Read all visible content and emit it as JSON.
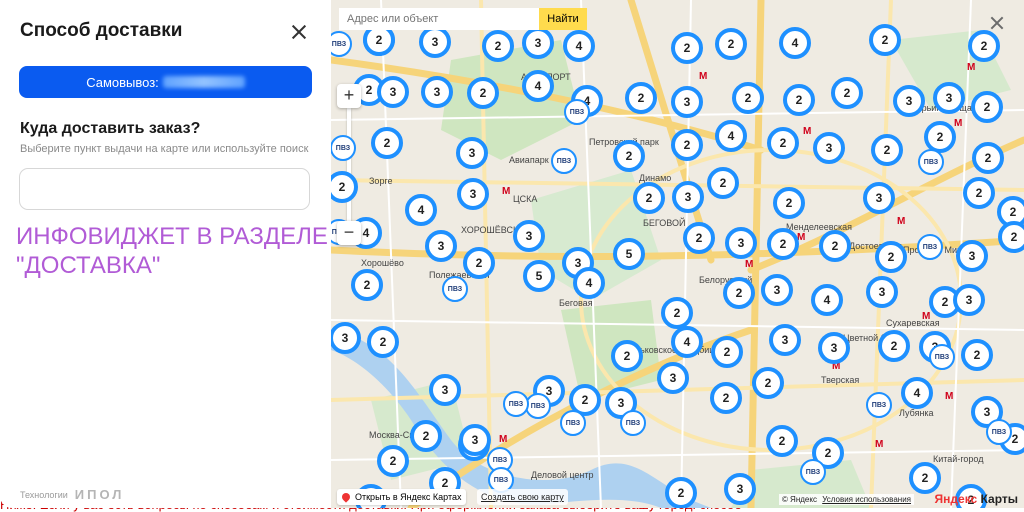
{
  "panel": {
    "title": "Способ доставки",
    "pickup_label": "Самовывоз:",
    "question": "Куда доставить заказ?",
    "hint": "Выберите пункт выдачи на карте или используйте поиск",
    "address_value": "",
    "tech_label": "Технологии",
    "brand_logo_text": "ИПОЛ"
  },
  "overlay_label": {
    "line1": "ИНФОВИДЖЕТ В РАЗДЕЛЕ",
    "line2": "\"ДОСТАВКА\""
  },
  "page_bg_text": "Ниже: Если у вас есть вопросы по способам и стоимости доставки. При оформлении заказа выберите вашу город. способ",
  "map": {
    "search_placeholder": "Адрес или объект",
    "search_button": "Найти",
    "zoom_in": "+",
    "zoom_out": "−",
    "open_in_yandex": "Открыть в Яндекс Картах",
    "create_map": "Создать свою карту",
    "copyright": "© Яндекс",
    "terms": "Условия использования",
    "logo_part1": "Яндекс",
    "logo_part2": " Карты",
    "accent_color": "#1e90ff",
    "button_color": "#ffdb4d",
    "pvz_label": "ПВЗ",
    "places": [
      "АЭРОПОРТ",
      "Авиапарк",
      "ЦСКА",
      "ХОРОШЁВСКИЙ",
      "Петровский парк",
      "Динамо",
      "БЕГОВОЙ",
      "Беговая",
      "Белорусский",
      "Менделеевская",
      "Достоевская",
      "Проспект Мира",
      "Марьина Роща",
      "Цветной бу...",
      "Тверская",
      "Лубянка",
      "Китай-город",
      "Деловой центр",
      "Ваганьковское кладбище",
      "Зорге",
      "Хорошёво",
      "Полежаевская",
      "Москва-Сити",
      "Сухаревская"
    ],
    "clusters": [
      "2",
      "3",
      "2",
      "3",
      "4",
      "2",
      "2",
      "4",
      "2",
      "2",
      "2",
      "3",
      "3",
      "2",
      "4",
      "4",
      "2",
      "3",
      "2",
      "2",
      "2",
      "3",
      "3",
      "2",
      "2",
      "3",
      "2",
      "2",
      "4",
      "2",
      "3",
      "2",
      "2",
      "2",
      "2",
      "4",
      "3",
      "2",
      "3",
      "2",
      "2",
      "3",
      "2",
      "2",
      "4",
      "3",
      "3",
      "5",
      "2",
      "3",
      "2",
      "2",
      "2",
      "3",
      "2",
      "2",
      "2",
      "5",
      "3",
      "4",
      "2",
      "2",
      "3",
      "4",
      "3",
      "2",
      "3",
      "3",
      "2",
      "4",
      "2",
      "3",
      "3",
      "2",
      "3",
      "2",
      "2",
      "3",
      "2",
      "4",
      "3",
      "2",
      "3",
      "2",
      "3",
      "2",
      "3",
      "2",
      "2",
      "3",
      "2",
      "2",
      "2",
      "3",
      "2",
      "3",
      "3",
      "2",
      "2",
      "2"
    ],
    "pvz_count": 18
  }
}
